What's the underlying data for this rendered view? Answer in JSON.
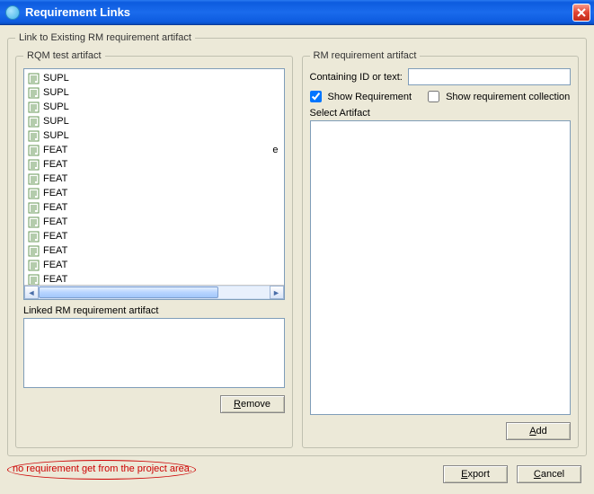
{
  "window": {
    "title": "Requirement Links"
  },
  "outer_legend": "Link to Existing RM requirement artifact",
  "left": {
    "legend": "RQM test artifact",
    "items": [
      "SUPL",
      "SUPL",
      "SUPL",
      "SUPL",
      "SUPL",
      "FEAT",
      "FEAT",
      "FEAT",
      "FEAT",
      "FEAT",
      "FEAT",
      "FEAT",
      "FEAT",
      "FEAT",
      "FEAT"
    ],
    "ellipsis_row_index": 5,
    "linked_label": "Linked RM requirement artifact",
    "remove_label": "Remove",
    "remove_u": "R"
  },
  "right": {
    "legend": "RM requirement artifact",
    "id_label": "Containing ID or text:",
    "id_value": "",
    "show_req_label": "Show Requirement",
    "show_req_checked": true,
    "show_coll_label": "Show requirement collection",
    "show_coll_checked": false,
    "select_label": "Select Artifact",
    "add_label": "Add",
    "add_u": "A"
  },
  "bottom": {
    "export_label": "Export",
    "export_u": "E",
    "cancel_label": "Cancel",
    "cancel_u": "C"
  },
  "warning_text": "no requirement get from the project area."
}
